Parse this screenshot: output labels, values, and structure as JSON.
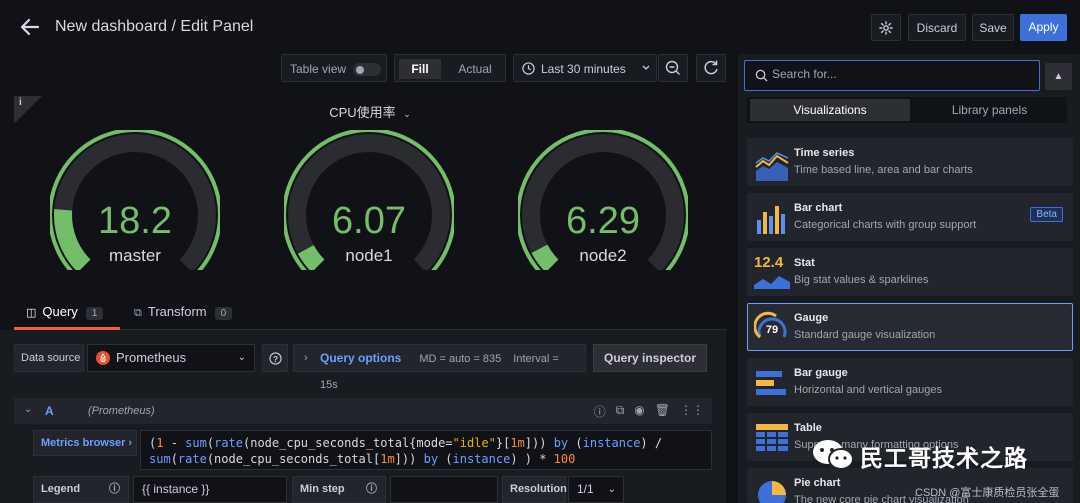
{
  "header": {
    "title": "New dashboard / Edit Panel",
    "discard_label": "Discard",
    "save_label": "Save",
    "apply_label": "Apply"
  },
  "panel_toolbar": {
    "table_view_label": "Table view",
    "fill_label": "Fill",
    "actual_label": "Actual",
    "time_range": "Last 30 minutes"
  },
  "panel": {
    "title": "CPU使用率",
    "gauges": [
      {
        "name": "master",
        "value": "18.2",
        "fraction": 0.182
      },
      {
        "name": "node1",
        "value": "6.07",
        "fraction": 0.0607
      },
      {
        "name": "node2",
        "value": "6.29",
        "fraction": 0.0629
      }
    ],
    "gauge_color": "#73bf69"
  },
  "tabs": {
    "query_label": "Query",
    "query_count": "1",
    "transform_label": "Transform",
    "transform_count": "0"
  },
  "datasource": {
    "label": "Data source",
    "selected": "Prometheus",
    "query_options_label": "Query options",
    "md_text": "MD = auto = 835",
    "interval_text": "Interval = 15s",
    "inspector_label": "Query inspector"
  },
  "query": {
    "letter": "A",
    "datasource_name": "(Prometheus)",
    "metrics_browser_label": "Metrics browser",
    "legend_label": "Legend",
    "legend_value": "{{ instance }}",
    "min_step_label": "Min step",
    "resolution_label": "Resolution",
    "resolution_value": "1/1"
  },
  "sidebar": {
    "search_placeholder": "Search for...",
    "tab_visualizations": "Visualizations",
    "tab_library": "Library panels",
    "items": [
      {
        "name": "Time series",
        "desc": "Time based line, area and bar charts"
      },
      {
        "name": "Bar chart",
        "desc": "Categorical charts with group support",
        "badge": "Beta"
      },
      {
        "name": "Stat",
        "desc": "Big stat values & sparklines",
        "icon_text": "12.4"
      },
      {
        "name": "Gauge",
        "desc": "Standard gauge visualization",
        "icon_text": "79"
      },
      {
        "name": "Bar gauge",
        "desc": "Horizontal and vertical gauges"
      },
      {
        "name": "Table",
        "desc": "Supports many formatting options"
      },
      {
        "name": "Pie chart",
        "desc": "The new core pie chart visualization"
      }
    ]
  },
  "watermark": {
    "text": "民工哥技术之路",
    "credit": "CSDN @富士康质检员张全蛋"
  }
}
